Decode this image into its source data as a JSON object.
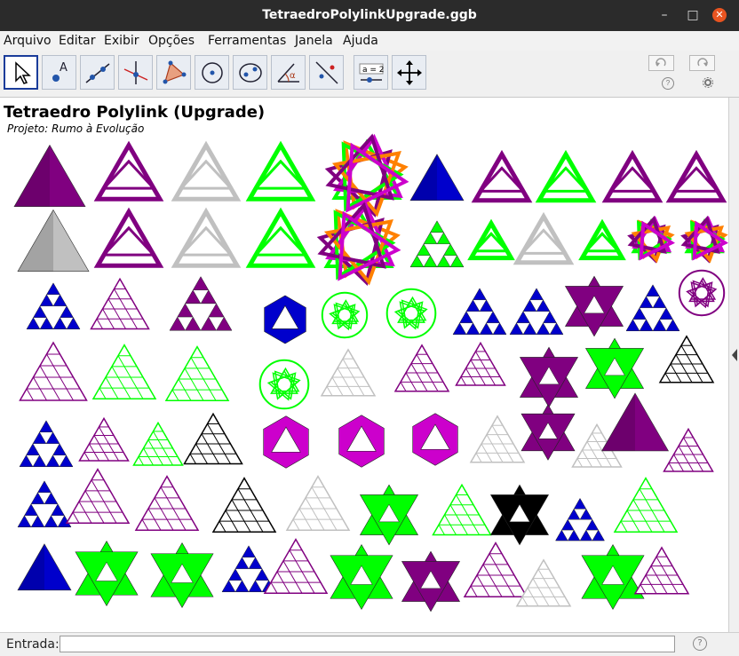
{
  "window": {
    "title": "TetraedroPolylinkUpgrade.ggb"
  },
  "menu": {
    "items": [
      "Arquivo",
      "Editar",
      "Exibir",
      "Opções",
      "Ferramentas",
      "Janela",
      "Ajuda"
    ]
  },
  "toolbar": {
    "tools": [
      "move-tool",
      "point-tool",
      "line-tool",
      "perpendicular-tool",
      "polygon-tool",
      "circle-tool",
      "conic-tool",
      "angle-tool",
      "reflect-tool",
      "slider-tool",
      "move-graphics-tool"
    ],
    "slider_label": "a = 2",
    "help_symbol": "?"
  },
  "canvas": {
    "title": "Tetraedro Polylink (Upgrade)",
    "subtitle": "Projeto: Rumo à Evolução"
  },
  "input": {
    "label": "Entrada:",
    "value": "",
    "help": "?"
  },
  "colors": {
    "purple": "#800080",
    "green": "#00ff00",
    "blue": "#0000cc",
    "gray": "#c0c0c0",
    "orange": "#ff8000",
    "magenta": "#cc00cc",
    "black": "#000000"
  }
}
